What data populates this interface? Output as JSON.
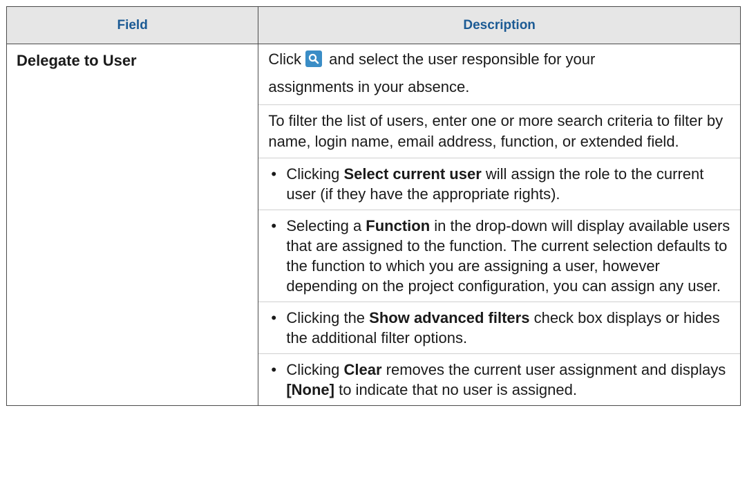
{
  "table": {
    "header": {
      "field": "Field",
      "description": "Description"
    },
    "row": {
      "field": "Delegate to User",
      "intro_prefix": "Click",
      "intro_suffix": "and select the user responsible for your",
      "intro_cont": "assignments in your absence.",
      "filter_text": "To filter the list of users, enter one or more search criteria to filter by name, login name, email address, function, or extended field.",
      "bullets": [
        {
          "pre": "Clicking ",
          "bold": "Select current user",
          "post": " will assign the role to the current user (if they have the appropriate rights)."
        },
        {
          "pre": "Selecting a ",
          "bold": "Function",
          "post": " in the drop-down will display available users that are assigned to the function. The current selection defaults to the function to which you are assigning a user, however depending on the project configuration, you can assign any user."
        },
        {
          "pre": "Clicking the ",
          "bold": "Show advanced filters",
          "post": " check box displays or hides the additional filter options."
        },
        {
          "pre": "Clicking ",
          "bold": "Clear",
          "post": " removes the current user assignment and displays ",
          "bold2": "[None]",
          "post2": " to indicate that no user is assigned."
        }
      ]
    }
  },
  "icons": {
    "lookup": "search-icon"
  },
  "colors": {
    "header_text": "#1b5a94",
    "header_bg": "#e6e6e6",
    "icon_bg": "#3a8dc6"
  }
}
